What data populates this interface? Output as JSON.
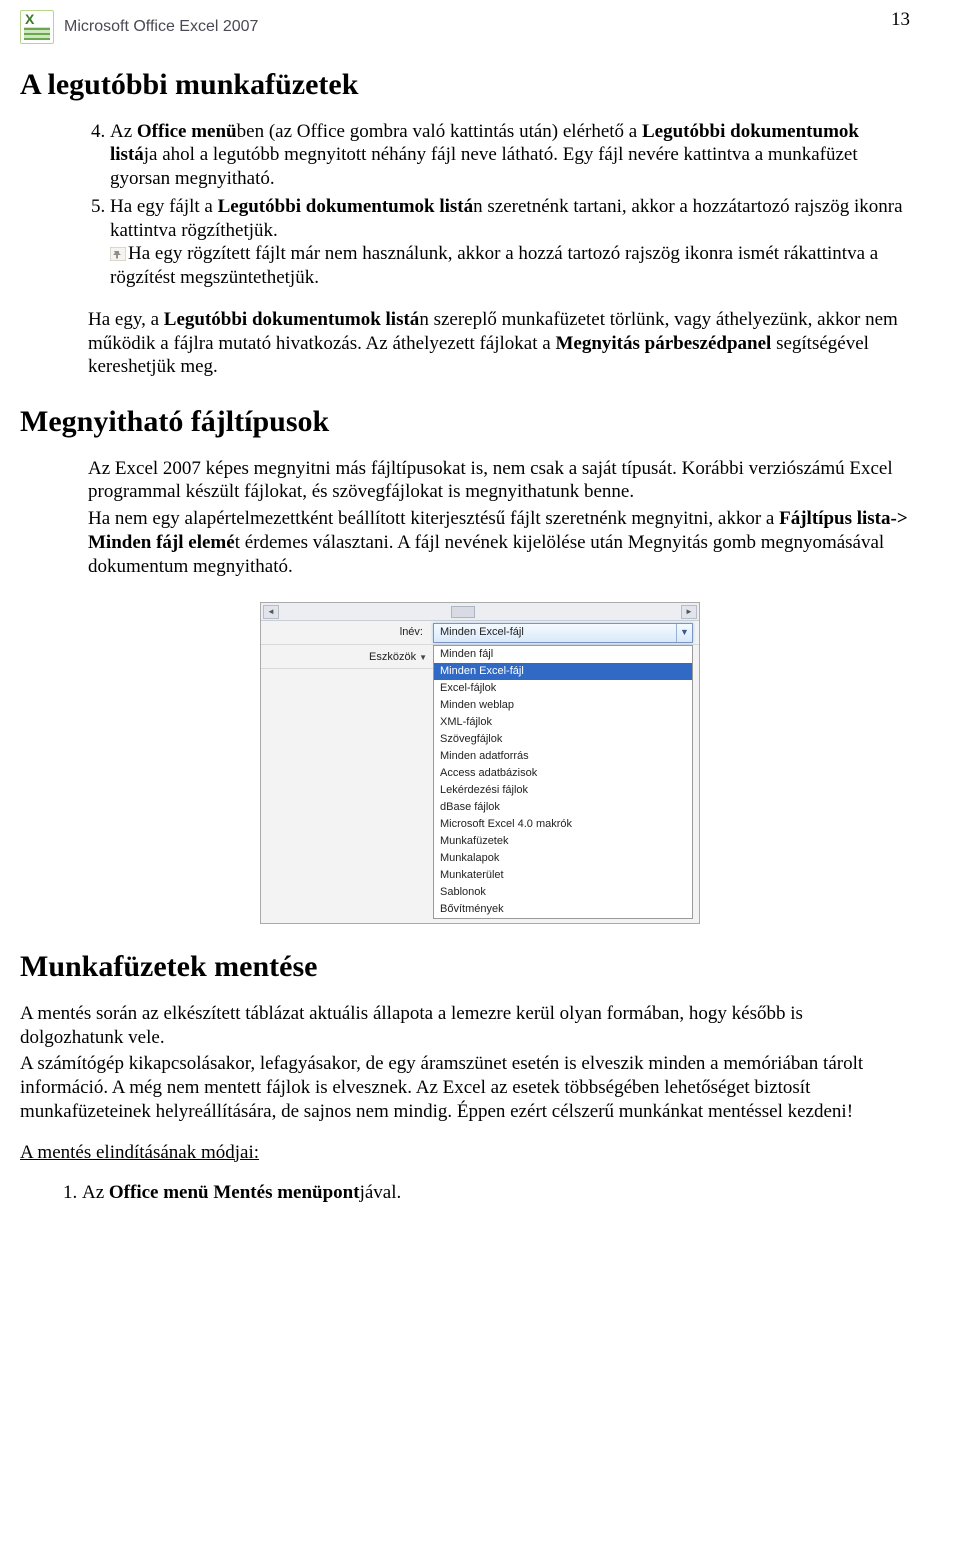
{
  "page_number": "13",
  "app_title": "Microsoft Office Excel 2007",
  "h1_a": "A legutóbbi munkafüzetek",
  "section_a": {
    "li4_pre": "Az ",
    "li4_b1": "Office menü",
    "li4_mid1": "ben (az Office gombra való kattintás után) elérhető a ",
    "li4_b2": "Legutóbbi dokumentumok listá",
    "li4_mid2": "ja ahol a legutóbb megnyitott néhány fájl neve látható. Egy fájl nevére kattintva a munkafüzet gyorsan megnyitható.",
    "li5_pre": "Ha egy fájlt a ",
    "li5_b1": "Legutóbbi dokumentumok listá",
    "li5_mid": "n szeretnénk tartani, akkor a hozzátartozó rajszög ikonra kattintva rögzíthetjük.",
    "pin_para": "Ha egy rögzített fájlt már nem használunk, akkor a hozzá tartozó rajszög ikonra ismét rákattintva a rögzítést megszüntethetjük.",
    "p2_pre": "Ha egy, a ",
    "p2_b1": "Legutóbbi dokumentumok listá",
    "p2_mid1": "n szereplő munkafüzetet törlünk, vagy áthelyezünk, akkor nem működik a fájlra mutató hivatkozás. Az áthelyezett fájlokat a ",
    "p2_b2": "Megnyitás párbeszédpanel",
    "p2_mid2": " segítségével kereshetjük meg."
  },
  "h1_b": "Megnyitható fájltípusok",
  "section_b": {
    "p1": "Az Excel 2007 képes megnyitni más fájltípusokat is, nem csak a saját típusát. Korábbi verziószámú Excel programmal készült fájlokat, és szövegfájlokat is megnyithatunk benne.",
    "p2_pre": "Ha nem egy alapértelmezettként beállított kiterjesztésű fájlt szeretnénk megnyitni, akkor a ",
    "p2_b1": "Fájltípus lista-> Minden fájl elemé",
    "p2_mid": "t érdemes választani. A fájl nevének kijelölése után Megnyitás gomb megnyomásával dokumentum megnyitható."
  },
  "screenshot": {
    "filename_label": "lnév:",
    "combo_value": "Minden Excel-fájl",
    "tools_label": "Eszközök",
    "list": [
      "Minden fájl",
      "Minden Excel-fájl",
      "Excel-fájlok",
      "Minden weblap",
      "XML-fájlok",
      "Szövegfájlok",
      "Minden adatforrás",
      "Access adatbázisok",
      "Lekérdezési fájlok",
      "dBase fájlok",
      "Microsoft Excel 4.0 makrók",
      "Munkafüzetek",
      "Munkalapok",
      "Munkaterület",
      "Sablonok",
      "Bővítmények"
    ],
    "selected_index": 1
  },
  "h1_c": "Munkafüzetek mentése",
  "section_c": {
    "p1": "A mentés során az elkészített táblázat aktuális állapota a lemezre kerül olyan formában, hogy később is dolgozhatunk vele.",
    "p2": "A számítógép kikapcsolásakor, lefagyásakor, de egy áramszünet esetén is elveszik minden a memóriában tárolt információ. A még nem mentett fájlok is elvesznek. Az Excel az esetek többségében lehetőséget biztosít munkafüzeteinek helyreállítására, de sajnos nem mindig. Éppen ezért célszerű munkánkat mentéssel kezdeni!",
    "p3_u": "A mentés elindításának módjai:",
    "li1_pre": "Az ",
    "li1_b": "Office menü Mentés menüpont",
    "li1_post": "jával."
  }
}
